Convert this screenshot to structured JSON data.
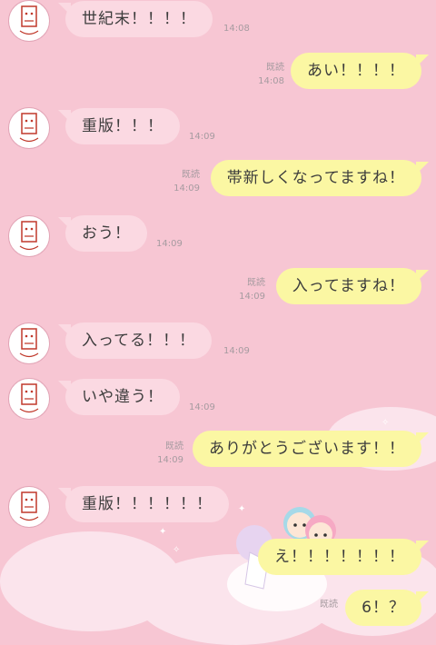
{
  "messages": [
    {
      "text": "世紀末！！！！",
      "time": "14:08"
    },
    {
      "text": "あい！！！！",
      "read": "既読",
      "time": "14:08"
    },
    {
      "text": "重版！！！",
      "time": "14:09"
    },
    {
      "text": "帯新しくなってますね！",
      "read": "既読",
      "time": "14:09"
    },
    {
      "text": "おう！",
      "time": "14:09"
    },
    {
      "text": "入ってますね！",
      "read": "既読",
      "time": "14:09"
    },
    {
      "text": "入ってる！！！",
      "time": "14:09"
    },
    {
      "text": "いや違う！",
      "time": "14:09"
    },
    {
      "text": "ありがとうございます！！",
      "read": "既読",
      "time": "14:09"
    },
    {
      "text": "重版！！！！！！",
      "time": ""
    },
    {
      "text": "え！！！！！！！",
      "read": "",
      "time": ""
    },
    {
      "text": "6！？",
      "read": "既読",
      "time": ""
    }
  ],
  "colors": {
    "background": "#f7c6d3",
    "incoming_bubble": "#fbd9e2",
    "outgoing_bubble": "#fbf7a3",
    "meta_text": "#a69ba0"
  },
  "icons": {
    "avatar": "stamp-face-icon"
  }
}
